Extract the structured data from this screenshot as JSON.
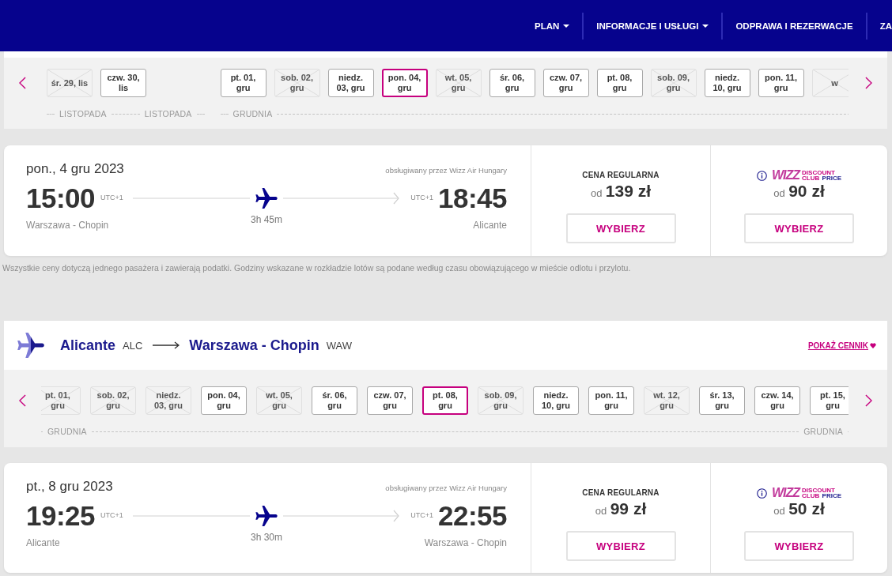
{
  "nav": {
    "items": [
      {
        "label": "PLAN",
        "kind": "dropdown"
      },
      {
        "label": "INFORMACJE I USŁUGI",
        "kind": "dropdown"
      },
      {
        "label": "ODPRAWA I REZERWACJE",
        "kind": "link"
      },
      {
        "label": "ZA",
        "kind": "link"
      }
    ]
  },
  "sections": [
    {
      "date_strip": {
        "groups": [
          {
            "months": [
              "LISTOPADA",
              "LISTOPADA"
            ],
            "days": [
              {
                "label": "śr. 29, lis",
                "selected": false,
                "disabled": true
              },
              {
                "label": "czw. 30, lis",
                "selected": false,
                "disabled": false
              }
            ]
          },
          {
            "months": [
              "GRUDNIA"
            ],
            "days": [
              {
                "label": "pt. 01, gru",
                "selected": false,
                "disabled": false
              },
              {
                "label": "sob. 02, gru",
                "selected": false,
                "disabled": true
              },
              {
                "label": "niedz. 03, gru",
                "selected": false,
                "disabled": false
              },
              {
                "label": "pon. 04, gru",
                "selected": true,
                "disabled": false
              },
              {
                "label": "wt. 05, gru",
                "selected": false,
                "disabled": true
              },
              {
                "label": "śr. 06, gru",
                "selected": false,
                "disabled": false
              },
              {
                "label": "czw. 07, gru",
                "selected": false,
                "disabled": false
              },
              {
                "label": "pt. 08, gru",
                "selected": false,
                "disabled": false
              },
              {
                "label": "sob. 09, gru",
                "selected": false,
                "disabled": true
              },
              {
                "label": "niedz. 10, gru",
                "selected": false,
                "disabled": false
              },
              {
                "label": "pon. 11, gru",
                "selected": false,
                "disabled": false
              },
              {
                "label": "w",
                "selected": false,
                "disabled": true
              }
            ]
          }
        ]
      },
      "flight": {
        "date": "pon., 4 gru 2023",
        "operator": "obsługiwany przez Wizz Air Hungary",
        "departure": {
          "time": "15:00",
          "utc": "UTC+1",
          "airport": "Warszawa - Chopin"
        },
        "arrival": {
          "time": "18:45",
          "utc": "UTC+1",
          "airport": "Alicante"
        },
        "duration": "3h 45m",
        "fares": [
          {
            "kind": "regular",
            "title": "CENA REGULARNA",
            "prefix": "od",
            "price": "139 zł",
            "button": "WYBIERZ"
          },
          {
            "kind": "club",
            "logo": {
              "brand": "WIZZ",
              "words": [
                "DISCOUNT",
                "CLUB",
                "PRICE"
              ]
            },
            "prefix": "od",
            "price": "90 zł",
            "button": "WYBIERZ"
          }
        ]
      },
      "footnote": "Wszystkie ceny dotyczą jednego pasażera i zawierają podatki. Godziny wskazane w rozkładzie lotów są podane według czasu obowiązującego w mieście odlotu i przylotu."
    },
    {
      "route": {
        "from": {
          "city": "Alicante",
          "code": "ALC"
        },
        "to": {
          "city": "Warszawa - Chopin",
          "code": "WAW"
        },
        "price_link": "POKAŻ CENNIK"
      },
      "date_strip": {
        "groups": [
          {
            "months": [
              "GRUDNIA",
              "GRUDNIA"
            ],
            "days": [
              {
                "label": "pt. 01, gru",
                "selected": false,
                "disabled": true
              },
              {
                "label": "sob. 02, gru",
                "selected": false,
                "disabled": true
              },
              {
                "label": "niedz. 03, gru",
                "selected": false,
                "disabled": true
              },
              {
                "label": "pon. 04, gru",
                "selected": false,
                "disabled": false
              },
              {
                "label": "wt. 05, gru",
                "selected": false,
                "disabled": true
              },
              {
                "label": "śr. 06, gru",
                "selected": false,
                "disabled": false
              },
              {
                "label": "czw. 07, gru",
                "selected": false,
                "disabled": false
              },
              {
                "label": "pt. 08, gru",
                "selected": true,
                "disabled": false
              },
              {
                "label": "sob. 09, gru",
                "selected": false,
                "disabled": true
              },
              {
                "label": "niedz. 10, gru",
                "selected": false,
                "disabled": false
              },
              {
                "label": "pon. 11, gru",
                "selected": false,
                "disabled": false
              },
              {
                "label": "wt. 12, gru",
                "selected": false,
                "disabled": true
              },
              {
                "label": "śr. 13, gru",
                "selected": false,
                "disabled": false
              },
              {
                "label": "czw. 14, gru",
                "selected": false,
                "disabled": false
              },
              {
                "label": "pt. 15, gru",
                "selected": false,
                "disabled": false
              }
            ]
          }
        ]
      },
      "flight": {
        "date": "pt., 8 gru 2023",
        "operator": "obsługiwany przez Wizz Air Hungary",
        "departure": {
          "time": "19:25",
          "utc": "UTC+1",
          "airport": "Alicante"
        },
        "arrival": {
          "time": "22:55",
          "utc": "UTC+1",
          "airport": "Warszawa - Chopin"
        },
        "duration": "3h 30m",
        "fares": [
          {
            "kind": "regular",
            "title": "CENA REGULARNA",
            "prefix": "od",
            "price": "99 zł",
            "button": "WYBIERZ"
          },
          {
            "kind": "club",
            "logo": {
              "brand": "WIZZ",
              "words": [
                "DISCOUNT",
                "CLUB",
                "PRICE"
              ]
            },
            "prefix": "od",
            "price": "50 zł",
            "button": "WYBIERZ"
          }
        ]
      }
    }
  ]
}
